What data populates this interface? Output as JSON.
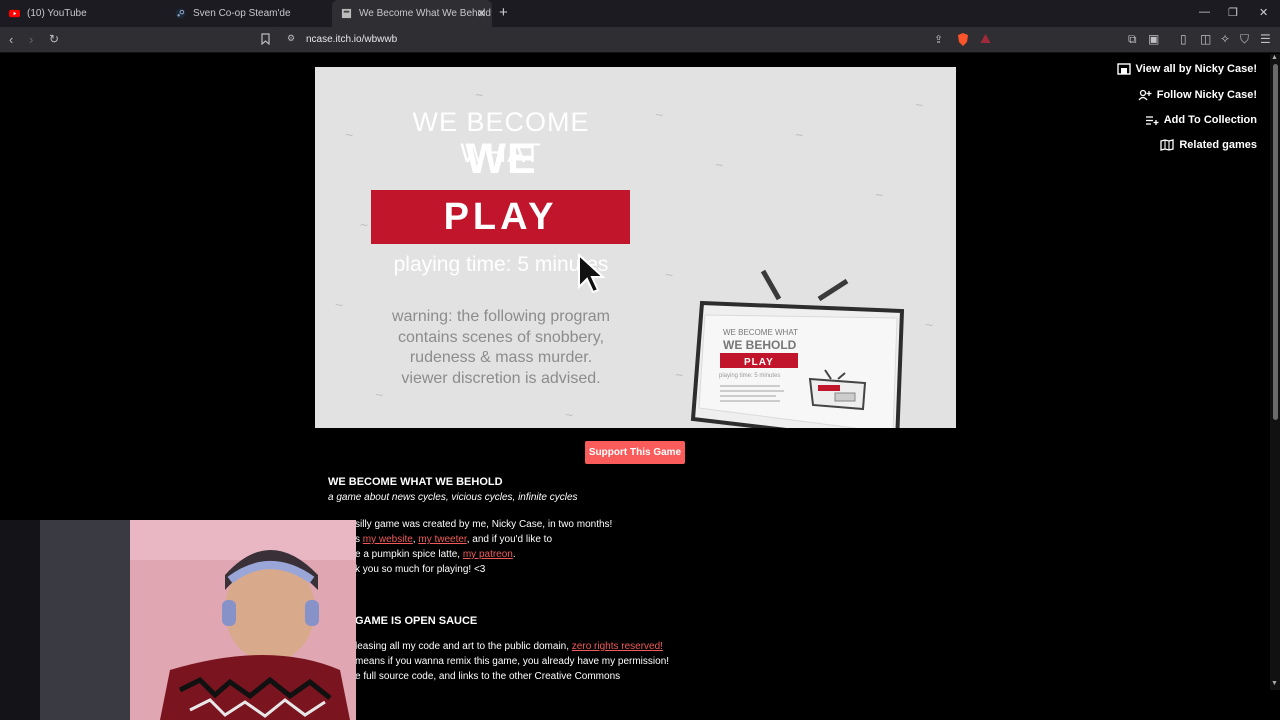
{
  "browser": {
    "tabs": [
      {
        "title": "(10) YouTube",
        "active": false
      },
      {
        "title": "Sven Co-op Steam'de",
        "active": false
      },
      {
        "title": "We Become What We Behold by",
        "active": true
      }
    ],
    "url": "ncase.itch.io/wbwwb"
  },
  "game": {
    "title_line1": "WE BECOME WHAT",
    "title_line2": "WE BEHOLD",
    "play_label": "PLAY",
    "playing_time": "playing time: 5 minutes",
    "warning": [
      "warning: the following program",
      "contains scenes of snobbery,",
      "rudeness & mass murder.",
      "viewer discretion is advised."
    ],
    "tv_title1": "WE BECOME WHAT",
    "tv_title2": "WE BEHOLD",
    "tv_play": "PLAY",
    "tv_time": "playing time: 5 minutes"
  },
  "sidebar": {
    "view_all": "View all by Nicky Case!",
    "follow": "Follow Nicky Case!",
    "add_collection": "Add To Collection",
    "related": "Related games"
  },
  "support_label": "Support This Game",
  "description": {
    "heading": "WE BECOME WHAT WE BEHOLD",
    "tagline": "a game about news cycles, vicious cycles, infinite cycles",
    "p1_line1": "silly game was created by me, Nicky Case, in two months!",
    "p1_line2_pre": "s ",
    "link_website": "my website",
    "link_sep": ", ",
    "link_tweeter": "my tweeter",
    "p1_line2_post": ", and if you'd like to",
    "p1_line3_pre": "e a pumpkin spice latte, ",
    "link_patreon": "my patreon",
    "p1_line3_post": ".",
    "p1_line4": "k you so much for playing! <3",
    "heading2": "GAME IS OPEN SAUCE",
    "p2_line1_pre": "leasing all my code and art to the public domain, ",
    "link_zero": "zero rights reserved!",
    "p2_line2": "means if you wanna remix this game, you already have my permission!",
    "p2_line3": "e full source code, and links to the other Creative Commons"
  },
  "colors": {
    "play_red": "#c0152a",
    "support_red": "#fa5c5c",
    "link_red": "#f05a5a",
    "game_bg": "#e2e2e2"
  }
}
